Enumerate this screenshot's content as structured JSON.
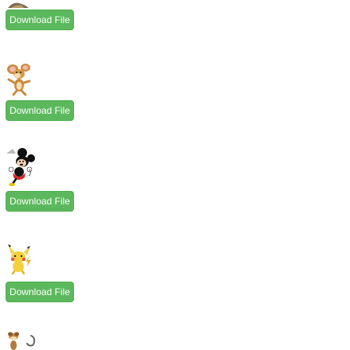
{
  "buttons": {
    "download_label": "Download File"
  },
  "colors": {
    "button_bg": "#5cb85c",
    "button_border": "#4cae4c",
    "button_text": "#ffffff"
  },
  "items": [
    {
      "image": "partial-cartoon-thumbnail-top",
      "button_label": "Download File"
    },
    {
      "image": "jerry-mouse-thumbnail",
      "button_label": "Download File"
    },
    {
      "image": "mickey-mouse-thumbnail",
      "button_label": "Download File"
    },
    {
      "image": "pikachu-thumbnail",
      "button_label": "Download File"
    },
    {
      "image": "partial-cartoon-thumbnail-bottom"
    }
  ]
}
